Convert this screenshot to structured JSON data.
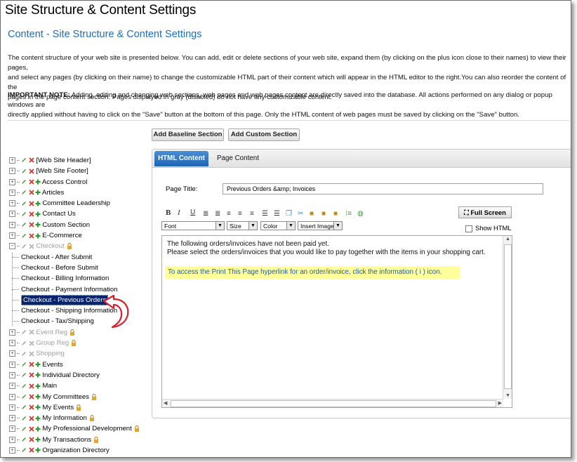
{
  "page": {
    "title": "Site Structure & Content Settings",
    "subtitle": "Content - Site Structure & Content Settings",
    "description_lines": [
      "The content structure of your web site is presented below. You can add, edit or delete sections of your web site, expand them (by clicking on the plus icon close to their names) to view their pages,",
      "and select any pages (by clicking on their name) to change the customizable HTML part of their content which will appear in the HTML editor to the right.You can also reorder the content of the",
      "pages in the page content section. Pages displayed in gray (disabled) do not have any customizable content."
    ],
    "note_label": "IMPORTANT NOTE:",
    "note_line1": " Adding, editing and changing web sections, web pages and web pages content are directly saved into the database. All actions performed on any dialog or popup windows are",
    "note_line2": "directly applied without having to click on the \"Save\" button at the bottom of this page. Only the HTML content of web pages must be saved by clicking on the \"Save\" button."
  },
  "buttons": {
    "add_baseline": "Add Baseline Section",
    "add_custom": "Add Custom Section"
  },
  "tree": [
    {
      "label": "[Web Site Header]",
      "plus": false,
      "gray": false,
      "lock": false
    },
    {
      "label": "[Web Site Footer]",
      "plus": false,
      "gray": false,
      "lock": false
    },
    {
      "label": "Access Control",
      "plus": true,
      "gray": false,
      "lock": false
    },
    {
      "label": "Articles",
      "plus": true,
      "gray": false,
      "lock": false
    },
    {
      "label": "Committee Leadership",
      "plus": true,
      "gray": false,
      "lock": false
    },
    {
      "label": "Contact Us",
      "plus": true,
      "gray": false,
      "lock": false
    },
    {
      "label": "Custom Section",
      "plus": true,
      "gray": false,
      "lock": false
    },
    {
      "label": "E-Commerce",
      "plus": true,
      "gray": false,
      "lock": false
    }
  ],
  "checkout": {
    "label": "Checkout",
    "children": [
      "Checkout - After Submit",
      "Checkout - Before Submit",
      "Checkout - Billing Information",
      "Checkout - Payment Information",
      "Checkout - Previous Orders",
      "Checkout - Shipping Information",
      "Checkout - Tax/Shipping"
    ]
  },
  "tree_after": [
    {
      "label": "Event Reg",
      "plus": false,
      "gray": true,
      "lock": true
    },
    {
      "label": "Group Reg",
      "plus": false,
      "gray": true,
      "lock": true
    },
    {
      "label": "Shopping",
      "plus": false,
      "gray": true,
      "lock": false
    },
    {
      "label": "Events",
      "plus": true,
      "gray": false,
      "lock": false
    },
    {
      "label": "Individual Directory",
      "plus": true,
      "gray": false,
      "lock": false
    },
    {
      "label": "Main",
      "plus": true,
      "gray": false,
      "lock": false
    },
    {
      "label": "My Committees",
      "plus": true,
      "gray": false,
      "lock": true
    },
    {
      "label": "My Events",
      "plus": true,
      "gray": false,
      "lock": true
    },
    {
      "label": "My Information",
      "plus": true,
      "gray": false,
      "lock": true
    },
    {
      "label": "My Professional Development",
      "plus": true,
      "gray": false,
      "lock": true
    },
    {
      "label": "My Transactions",
      "plus": true,
      "gray": false,
      "lock": true
    },
    {
      "label": "Organization Directory",
      "plus": true,
      "gray": false,
      "lock": false
    }
  ],
  "tabs": {
    "html_content": "HTML Content",
    "page_content": "Page Content"
  },
  "form": {
    "page_title_label": "Page Title:",
    "page_title_value": "Previous Orders &amp; Invoices"
  },
  "editor": {
    "fullscreen_label": "Full Screen",
    "font_label": "Font",
    "size_label": "Size",
    "color_label": "Color",
    "insert_image_label": "Insert Image",
    "show_html_label": "Show HTML",
    "line1": "The following orders/invoices have not been paid yet.",
    "line2": "Please select the orders/invoices that you would like to pay together with the items in your shopping cart.",
    "highlight": "To access the Print This Page hyperlink for an order/invoice, click the information ( i ) icon."
  },
  "colors": {
    "accent_blue": "#1b6ec2",
    "tab_active": "#2a73c4",
    "selection": "#0a246a",
    "highlight_bg": "#ffff9c",
    "arrow_red": "#d81f2a"
  }
}
